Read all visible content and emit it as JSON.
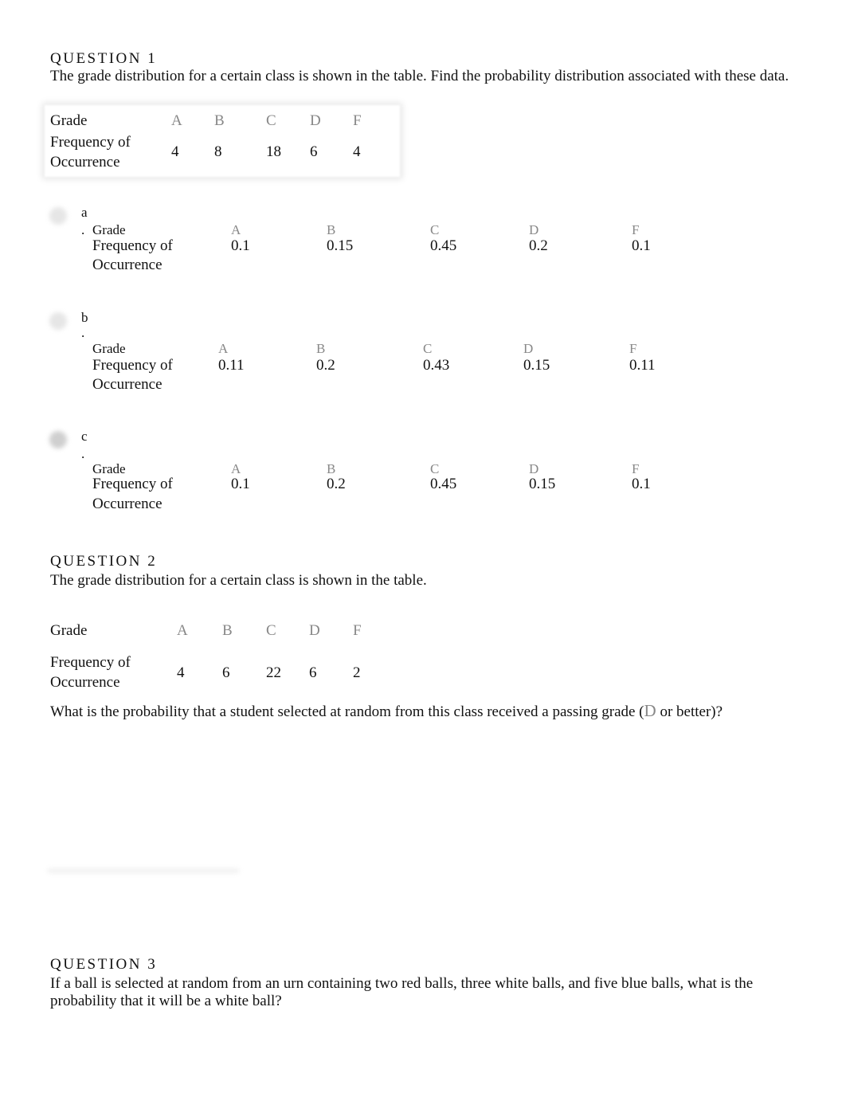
{
  "q1": {
    "heading": "QUESTION 1",
    "prompt": "The grade distribution for a certain class is shown in the table. Find the probability distribution associated with these data.",
    "table": {
      "grade_label": "Grade",
      "freq_label_1": "Frequency of",
      "freq_label_2": "Occurrence",
      "grades": [
        "A",
        "B",
        "C",
        "D",
        "F"
      ],
      "values": [
        "4",
        "8",
        "18",
        "6",
        "4"
      ]
    },
    "options": [
      {
        "letter": "a",
        "dot": ".",
        "grade_label": "Grade",
        "freq_label_1": "Frequency of",
        "freq_label_2": "Occurrence",
        "grades": [
          "A",
          "B",
          "C",
          "D",
          "F"
        ],
        "values": [
          "0.1",
          "0.15",
          "0.45",
          "0.2",
          "0.1"
        ],
        "selected": false
      },
      {
        "letter": "b",
        "dot": ".",
        "grade_label": "Grade",
        "freq_label_1": "Frequency of",
        "freq_label_2": "Occurrence",
        "grades": [
          "A",
          "B",
          "C",
          "D",
          "F"
        ],
        "values": [
          "0.11",
          "0.2",
          "0.43",
          "0.15",
          "0.11"
        ],
        "selected": false
      },
      {
        "letter": "c",
        "dot": ".",
        "grade_label": "Grade",
        "freq_label_1": "Frequency of",
        "freq_label_2": "Occurrence",
        "grades": [
          "A",
          "B",
          "C",
          "D",
          "F"
        ],
        "values": [
          "0.1",
          "0.2",
          "0.45",
          "0.15",
          "0.1"
        ],
        "selected": true
      }
    ]
  },
  "q2": {
    "heading": "QUESTION 2",
    "prompt": "The grade distribution for a certain class is shown in the table.",
    "table": {
      "grade_label": "Grade",
      "freq_label_1": "Frequency of",
      "freq_label_2": "Occurrence",
      "grades": [
        "A",
        "B",
        "C",
        "D",
        "F"
      ],
      "values": [
        "4",
        "6",
        "22",
        "6",
        "2"
      ]
    },
    "question_before": "What is the probability that a student selected at random from this class received a passing grade (",
    "question_grade": "D",
    "question_after": " or better)?"
  },
  "q3": {
    "heading": "QUESTION 3",
    "prompt_1": "If a ball is selected at random from an urn containing two red balls, three white balls, and five blue balls, what is the",
    "prompt_2": "probability that it will be a white ball?"
  }
}
